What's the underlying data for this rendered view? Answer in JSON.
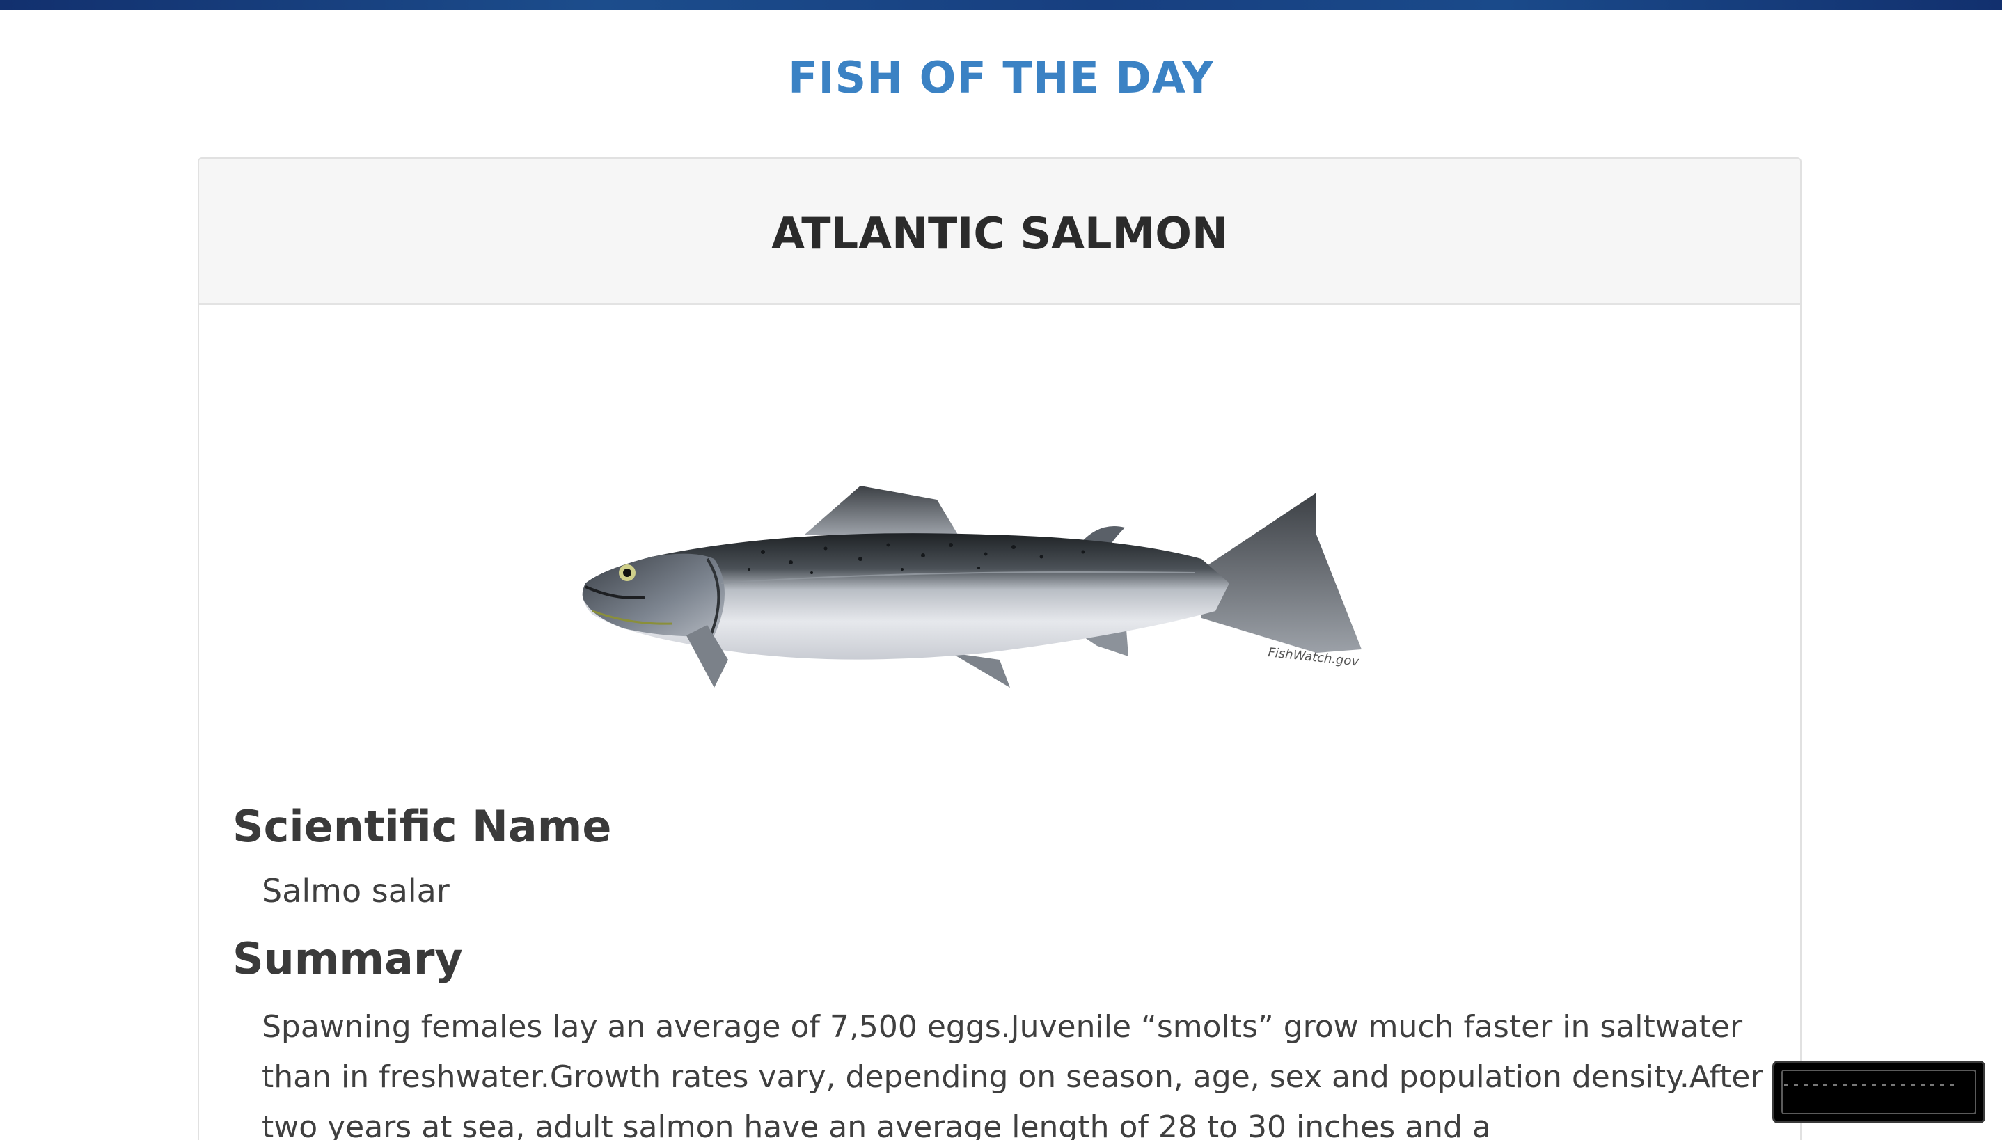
{
  "site": {
    "title": "FISH OF THE DAY"
  },
  "fish": {
    "name": "ATLANTIC SALMON",
    "image_credit": "FishWatch.gov",
    "scientific_name_heading": "Scientific Name",
    "scientific_name": "Salmo salar",
    "summary_heading": "Summary",
    "summary": "Spawning females lay an average of 7,500 eggs.Juvenile “smolts” grow much faster in saltwater than in freshwater.Growth rates vary, depending on season, age, sex and population density.After two years at sea, adult salmon have an average length of 28 to 30 inches and a"
  },
  "colors": {
    "title": "#3b82c4",
    "header_bg": "#f6f6f6",
    "top_bar": "#173f80"
  },
  "icons": {
    "fish_image": "atlantic-salmon-illustration",
    "widget": "media-player-widget"
  }
}
